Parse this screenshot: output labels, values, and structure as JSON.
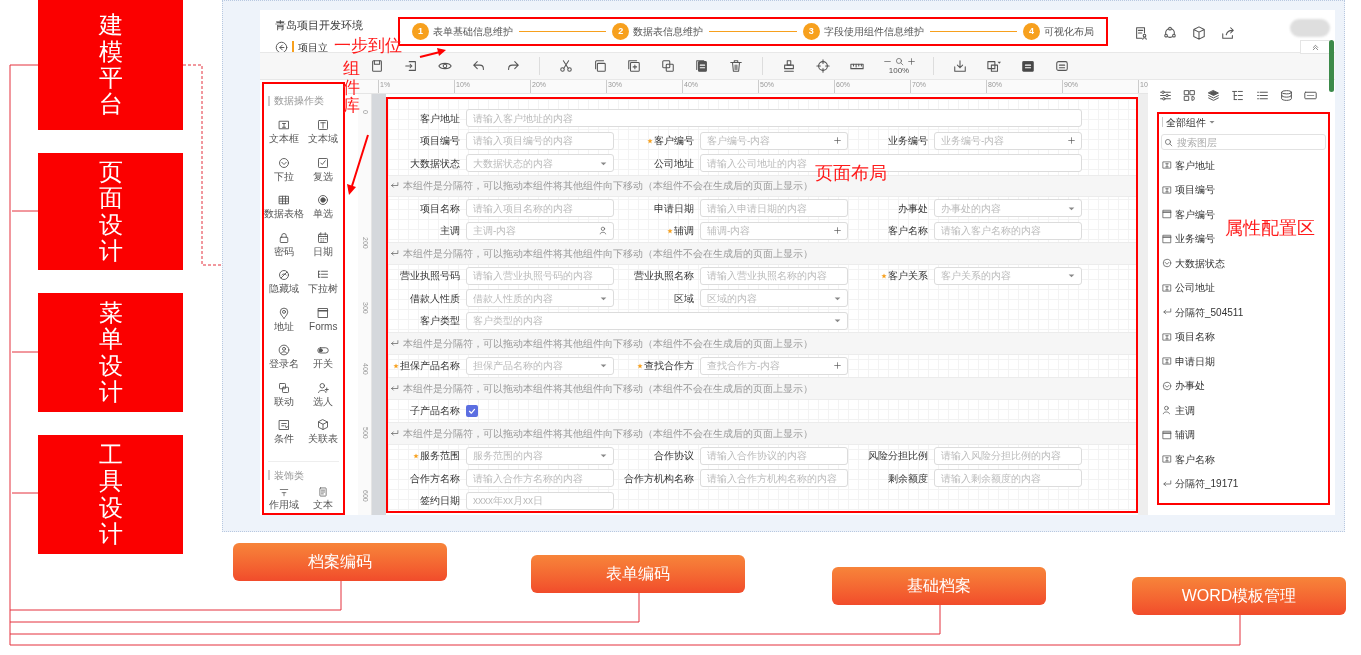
{
  "modules": [
    {
      "label": "建模平台"
    },
    {
      "label": "页面设计"
    },
    {
      "label": "菜单设计"
    },
    {
      "label": "工具设计"
    }
  ],
  "outputs": [
    {
      "label": "档案编码"
    },
    {
      "label": "表单编码"
    },
    {
      "label": "基础档案"
    },
    {
      "label": "WORD模板管理"
    }
  ],
  "annotations": {
    "steps": "一步到位",
    "palette": "组件库",
    "canvas": "页面布局",
    "properties": "属性配置区"
  },
  "app": {
    "title": "青岛项目开发环境",
    "breadcrumb": "项目立",
    "steps": [
      {
        "number": "1",
        "label": "表单基础信息维护"
      },
      {
        "number": "2",
        "label": "数据表信息维护"
      },
      {
        "number": "3",
        "label": "字段使用组件信息维护"
      },
      {
        "number": "4",
        "label": "可视化布局"
      }
    ],
    "zoom": "100%",
    "ruler": [
      "1%",
      "10%",
      "20%",
      "30%",
      "40%",
      "50%",
      "60%",
      "70%",
      "80%",
      "90%",
      "10"
    ],
    "vertical_ruler": [
      "0",
      "200",
      "300",
      "400",
      "500",
      "600"
    ],
    "palette": {
      "sections": [
        {
          "title": "数据操作类",
          "items": [
            {
              "label": "文本框",
              "kind": "textbox"
            },
            {
              "label": "文本域",
              "kind": "textarea"
            },
            {
              "label": "下拉",
              "kind": "dropdown"
            },
            {
              "label": "复选",
              "kind": "checkbox"
            },
            {
              "label": "数据表格",
              "kind": "table"
            },
            {
              "label": "单选",
              "kind": "radio"
            },
            {
              "label": "密码",
              "kind": "password"
            },
            {
              "label": "日期",
              "kind": "date"
            },
            {
              "label": "隐藏域",
              "kind": "hidden"
            },
            {
              "label": "下拉树",
              "kind": "tree"
            },
            {
              "label": "地址",
              "kind": "address"
            },
            {
              "label": "Forms",
              "kind": "form"
            },
            {
              "label": "登录名",
              "kind": "login"
            },
            {
              "label": "开关",
              "kind": "switch"
            },
            {
              "label": "联动",
              "kind": "linkage"
            },
            {
              "label": "选人",
              "kind": "person-picker"
            },
            {
              "label": "条件",
              "kind": "condition"
            },
            {
              "label": "关联表",
              "kind": "relation"
            }
          ]
        },
        {
          "title": "装饰类",
          "items": [
            {
              "label": "作用域",
              "kind": "scope"
            },
            {
              "label": "文本",
              "kind": "text"
            }
          ]
        }
      ]
    },
    "form": {
      "rows": [
        {
          "kind": "fields",
          "fields": [
            {
              "label": "客户地址",
              "required": false,
              "kind": "text3",
              "placeholder": "请输入客户地址的内容"
            }
          ]
        },
        {
          "kind": "fields",
          "fields": [
            {
              "label": "项目编号",
              "required": false,
              "kind": "text",
              "placeholder": "请输入项目编号的内容"
            },
            {
              "label": "客户编号",
              "required": true,
              "kind": "add",
              "placeholder": "客户编号-内容"
            },
            {
              "label": "业务编号",
              "required": false,
              "kind": "add",
              "placeholder": "业务编号-内容"
            }
          ]
        },
        {
          "kind": "fields",
          "fields": [
            {
              "label": "大数据状态",
              "required": false,
              "kind": "select",
              "placeholder": "大数据状态的内容"
            },
            {
              "label": "公司地址",
              "required": false,
              "kind": "text2",
              "placeholder": "请输入公司地址的内容"
            }
          ]
        },
        {
          "kind": "separator",
          "text": "本组件是分隔符，可以拖动本组件将其他组件向下移动（本组件不会在生成后的页面上显示）"
        },
        {
          "kind": "fields",
          "fields": [
            {
              "label": "项目名称",
              "required": false,
              "kind": "text",
              "placeholder": "请输入项目名称的内容"
            },
            {
              "label": "申请日期",
              "required": false,
              "kind": "text",
              "placeholder": "请输入申请日期的内容"
            },
            {
              "label": "办事处",
              "required": false,
              "kind": "select",
              "placeholder": "办事处的内容"
            }
          ]
        },
        {
          "kind": "fields",
          "fields": [
            {
              "label": "主调",
              "required": false,
              "kind": "person",
              "placeholder": "主调-内容"
            },
            {
              "label": "辅调",
              "required": true,
              "kind": "add",
              "placeholder": "辅调-内容"
            },
            {
              "label": "客户名称",
              "required": false,
              "kind": "text",
              "placeholder": "请输入客户名称的内容"
            }
          ]
        },
        {
          "kind": "separator",
          "text": "本组件是分隔符，可以拖动本组件将其他组件向下移动（本组件不会在生成后的页面上显示）"
        },
        {
          "kind": "fields",
          "fields": [
            {
              "label": "营业执照号码",
              "required": false,
              "kind": "text",
              "placeholder": "请输入营业执照号码的内容"
            },
            {
              "label": "营业执照名称",
              "required": false,
              "kind": "text",
              "placeholder": "请输入营业执照名称的内容"
            },
            {
              "label": "客户关系",
              "required": true,
              "kind": "select",
              "placeholder": "客户关系的内容"
            }
          ]
        },
        {
          "kind": "fields",
          "fields": [
            {
              "label": "借款人性质",
              "required": false,
              "kind": "select",
              "placeholder": "借款人性质的内容"
            },
            {
              "label": "区域",
              "required": false,
              "kind": "select",
              "placeholder": "区域的内容"
            }
          ]
        },
        {
          "kind": "fields",
          "fields": [
            {
              "label": "客户类型",
              "required": false,
              "kind": "select2",
              "placeholder": "客户类型的内容"
            }
          ]
        },
        {
          "kind": "separator",
          "text": "本组件是分隔符，可以拖动本组件将其他组件向下移动（本组件不会在生成后的页面上显示）"
        },
        {
          "kind": "fields",
          "fields": [
            {
              "label": "担保产品名称",
              "required": true,
              "kind": "select",
              "placeholder": "担保产品名称的内容"
            },
            {
              "label": "查找合作方",
              "required": true,
              "kind": "add",
              "placeholder": "查找合作方-内容"
            }
          ]
        },
        {
          "kind": "separator",
          "text": "本组件是分隔符，可以拖动本组件将其他组件向下移动（本组件不会在生成后的页面上显示）"
        },
        {
          "kind": "fields",
          "fields": [
            {
              "label": "子产品名称",
              "required": false,
              "kind": "checkbox",
              "checked": true
            }
          ]
        },
        {
          "kind": "separator",
          "text": "本组件是分隔符，可以拖动本组件将其他组件向下移动（本组件不会在生成后的页面上显示）"
        },
        {
          "kind": "fields",
          "fields": [
            {
              "label": "服务范围",
              "required": true,
              "kind": "select",
              "placeholder": "服务范围的内容"
            },
            {
              "label": "合作协议",
              "required": false,
              "kind": "text",
              "placeholder": "请输入合作协议的内容"
            },
            {
              "label": "风险分担比例",
              "required": false,
              "kind": "text",
              "placeholder": "请输入风险分担比例的内容"
            }
          ]
        },
        {
          "kind": "fields",
          "fields": [
            {
              "label": "合作方名称",
              "required": false,
              "kind": "text",
              "placeholder": "请输入合作方名称的内容"
            },
            {
              "label": "合作方机构名称",
              "required": false,
              "kind": "text",
              "placeholder": "请输入合作方机构名称的内容"
            },
            {
              "label": "剩余额度",
              "required": false,
              "kind": "text",
              "placeholder": "请输入剩余额度的内容"
            }
          ]
        },
        {
          "kind": "fields",
          "fields": [
            {
              "label": "签约日期",
              "required": false,
              "kind": "text",
              "placeholder": "xxxx年xx月xx日"
            }
          ]
        }
      ]
    },
    "layers": {
      "title": "全部组件",
      "search_placeholder": "搜索图层",
      "items": [
        {
          "label": "客户地址",
          "kind": "textbox"
        },
        {
          "label": "项目编号",
          "kind": "textbox"
        },
        {
          "label": "客户编号",
          "kind": "window"
        },
        {
          "label": "业务编号",
          "kind": "window"
        },
        {
          "label": "大数据状态",
          "kind": "dropdown"
        },
        {
          "label": "公司地址",
          "kind": "textbox"
        },
        {
          "label": "分隔符_504511",
          "kind": "separator"
        },
        {
          "label": "项目名称",
          "kind": "textbox"
        },
        {
          "label": "申请日期",
          "kind": "textbox"
        },
        {
          "label": "办事处",
          "kind": "dropdown"
        },
        {
          "label": "主调",
          "kind": "person"
        },
        {
          "label": "辅调",
          "kind": "window"
        },
        {
          "label": "客户名称",
          "kind": "textbox"
        },
        {
          "label": "分隔符_19171",
          "kind": "separator"
        }
      ]
    }
  }
}
